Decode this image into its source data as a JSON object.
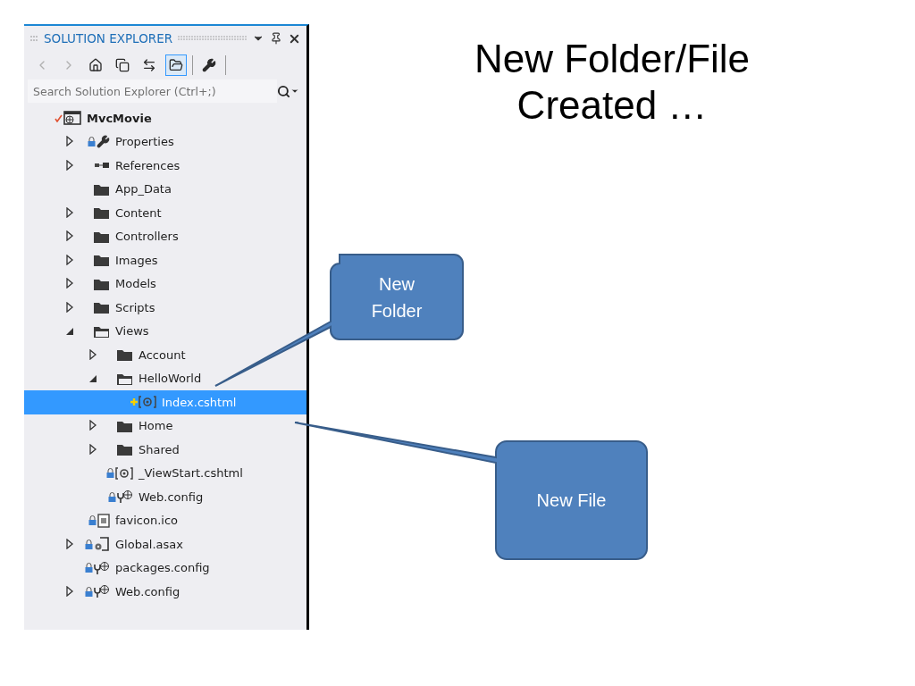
{
  "panel": {
    "title": "SOLUTION EXPLORER",
    "toolbar": [
      {
        "kind": "back",
        "disabled": true,
        "selected": false
      },
      {
        "kind": "forward",
        "disabled": true,
        "selected": false
      },
      {
        "kind": "home",
        "disabled": false,
        "selected": false
      },
      {
        "kind": "collapse",
        "disabled": false,
        "selected": false
      },
      {
        "kind": "sync",
        "disabled": false,
        "selected": false
      },
      {
        "kind": "show-all",
        "disabled": false,
        "selected": true
      },
      {
        "kind": "separator"
      },
      {
        "kind": "properties",
        "disabled": false,
        "selected": false
      },
      {
        "kind": "separator"
      }
    ],
    "search": {
      "placeholder": "Search Solution Explorer (Ctrl+;)"
    },
    "tree": [
      {
        "label": "MvcMovie",
        "kind": "project",
        "checked": true,
        "selected": false,
        "children": [
          {
            "label": "Properties",
            "kind": "wrench",
            "locked": true,
            "expanded": false,
            "selected": false
          },
          {
            "label": "References",
            "kind": "references",
            "locked": false,
            "expanded": false,
            "selected": false
          },
          {
            "label": "App_Data",
            "kind": "folder",
            "locked": false,
            "selected": false
          },
          {
            "label": "Content",
            "kind": "folder",
            "locked": false,
            "expanded": false,
            "selected": false
          },
          {
            "label": "Controllers",
            "kind": "folder",
            "locked": false,
            "expanded": false,
            "selected": false
          },
          {
            "label": "Images",
            "kind": "folder",
            "locked": false,
            "expanded": false,
            "selected": false
          },
          {
            "label": "Models",
            "kind": "folder",
            "locked": false,
            "expanded": false,
            "selected": false
          },
          {
            "label": "Scripts",
            "kind": "folder",
            "locked": false,
            "expanded": false,
            "selected": false
          },
          {
            "label": "Views",
            "kind": "folder",
            "locked": false,
            "expanded": true,
            "selected": false,
            "children": [
              {
                "label": "Account",
                "kind": "folder",
                "locked": false,
                "expanded": false,
                "selected": false
              },
              {
                "label": "HelloWorld",
                "kind": "folder",
                "locked": false,
                "expanded": true,
                "selected": false,
                "children": [
                  {
                    "label": "Index.cshtml",
                    "kind": "razor",
                    "locked": false,
                    "added": true,
                    "selected": true
                  }
                ]
              },
              {
                "label": "Home",
                "kind": "folder",
                "locked": false,
                "expanded": false,
                "selected": false
              },
              {
                "label": "Shared",
                "kind": "folder",
                "locked": false,
                "expanded": false,
                "selected": false
              },
              {
                "label": "_ViewStart.cshtml",
                "kind": "razor",
                "locked": true,
                "selected": false
              },
              {
                "label": "Web.config",
                "kind": "config",
                "locked": true,
                "selected": false
              }
            ]
          },
          {
            "label": "favicon.ico",
            "kind": "image",
            "locked": true,
            "selected": false
          },
          {
            "label": "Global.asax",
            "kind": "asax",
            "locked": true,
            "expanded": false,
            "selected": false
          },
          {
            "label": "packages.config",
            "kind": "config",
            "locked": true,
            "selected": false
          },
          {
            "label": "Web.config",
            "kind": "config",
            "locked": true,
            "expanded": false,
            "selected": false
          }
        ]
      }
    ]
  },
  "title": [
    "New Folder/File",
    "Created …"
  ],
  "callouts": [
    {
      "text": [
        "New",
        "Folder"
      ]
    },
    {
      "text": [
        "New File"
      ]
    }
  ]
}
